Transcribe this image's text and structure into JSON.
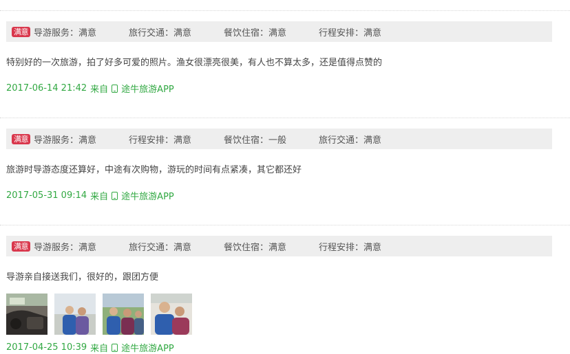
{
  "reviews": [
    {
      "badge": "满意",
      "ratings": [
        "导游服务：满意",
        "旅行交通：满意",
        "餐饮住宿：满意",
        "行程安排：满意"
      ],
      "comment": "特别好的一次旅游，拍了好多可爱的照片。渔女很漂亮很美，有人也不算太多，还是值得点赞的",
      "datetime": "2017-06-14 21:42",
      "source_prefix": "来自",
      "source": "途牛旅游APP"
    },
    {
      "badge": "满意",
      "ratings": [
        "导游服务：满意",
        "行程安排：满意",
        "餐饮住宿：一般",
        "旅行交通：满意"
      ],
      "comment": "旅游时导游态度还算好，中途有次购物，游玩的时间有点紧凑，其它都还好",
      "datetime": "2017-05-31 09:14",
      "source_prefix": "来自",
      "source": "途牛旅游APP"
    },
    {
      "badge": "满意",
      "ratings": [
        "导游服务：满意",
        "旅行交通：满意",
        "餐饮住宿：满意",
        "行程安排：满意"
      ],
      "comment": "导游亲自接送我们，很好的，跟团方便",
      "datetime": "2017-04-25 10:39",
      "source_prefix": "来自",
      "source": "途牛旅游APP"
    }
  ],
  "icons": {
    "source_icon": "mobile-phone-icon"
  },
  "colors": {
    "badge": "#d9374c",
    "meta": "#31a842",
    "tagbar": "#eeeeee"
  }
}
